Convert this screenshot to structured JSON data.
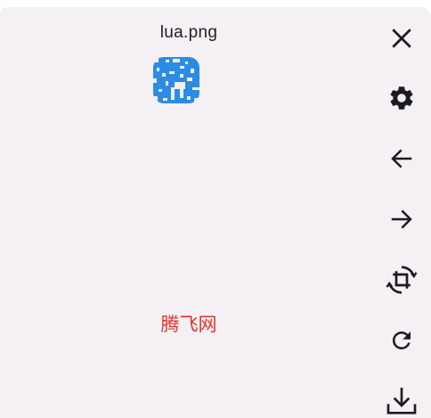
{
  "file": {
    "name": "lua.png"
  },
  "caption": {
    "text": "腾飞网",
    "color": "#e0322d"
  },
  "colors": {
    "accent": "#2a8ce6",
    "icon": "#1c1b1f",
    "panel_background": "#f4f0f3"
  },
  "toolbar": {
    "buttons": [
      {
        "name": "close",
        "icon": "close-icon"
      },
      {
        "name": "settings",
        "icon": "gear-icon"
      },
      {
        "name": "previous",
        "icon": "arrow-left-icon"
      },
      {
        "name": "next",
        "icon": "arrow-right-icon"
      },
      {
        "name": "crop-rotate",
        "icon": "crop-rotate-icon"
      },
      {
        "name": "refresh",
        "icon": "refresh-icon"
      },
      {
        "name": "download",
        "icon": "download-icon"
      }
    ]
  }
}
